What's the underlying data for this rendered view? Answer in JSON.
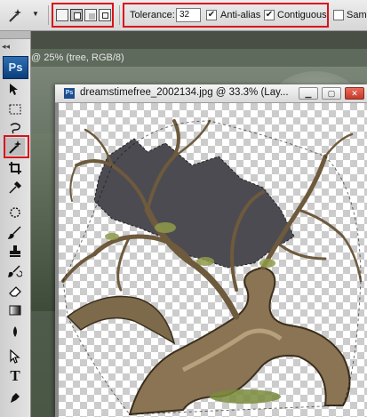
{
  "options_bar": {
    "tolerance_label": "Tolerance:",
    "tolerance_value": "32",
    "anti_alias_label": "Anti-alias",
    "anti_alias_checked": true,
    "contiguous_label": "Contiguous",
    "contiguous_checked": true,
    "sample_label": "Sampl",
    "accent_color": "#d9121b"
  },
  "tool_panel": {
    "logo": "Ps",
    "tools": [
      "move-icon",
      "marquee-icon",
      "lasso-icon",
      "magic-wand-icon",
      "crop-icon",
      "eyedropper-icon",
      "healing-icon",
      "brush-icon",
      "clone-stamp-icon",
      "history-brush-icon",
      "eraser-icon",
      "gradient-icon",
      "dodge-icon",
      "path-select-icon",
      "type-icon"
    ],
    "active_tool": "magic-wand-icon"
  },
  "background_document": {
    "title": "@ 25% (tree, RGB/8)"
  },
  "document": {
    "icon_text": "Ps",
    "title": "dreamstimefree_2002134.jpg @ 33.3% (Lay..."
  }
}
